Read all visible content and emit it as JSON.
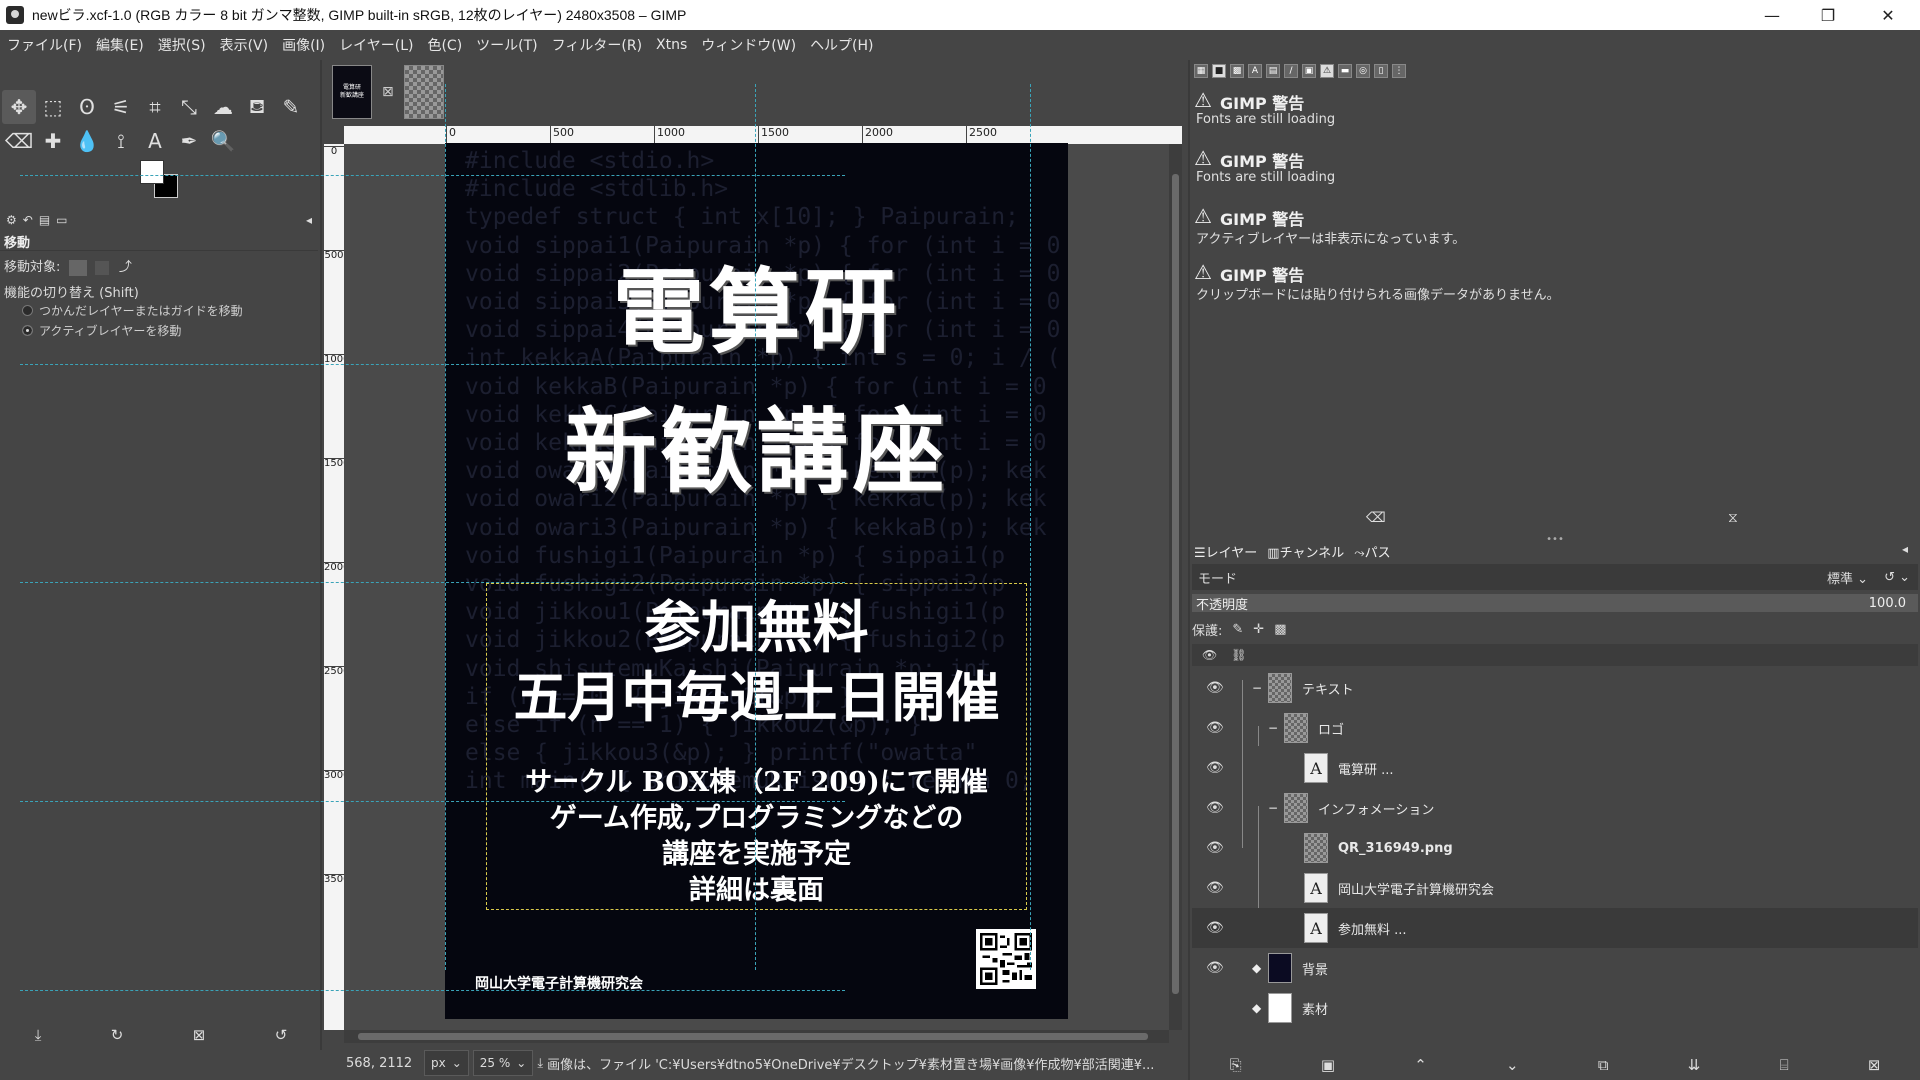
{
  "window": {
    "title": "newビラ.xcf-1.0 (RGB カラー 8 bit ガンマ整数, GIMP built-in sRGB, 12枚のレイヤー) 2480x3508 – GIMP",
    "minimize": "—",
    "maximize": "❐",
    "close": "✕"
  },
  "menu": [
    "ファイル(F)",
    "編集(E)",
    "選択(S)",
    "表示(V)",
    "画像(I)",
    "レイヤー(L)",
    "色(C)",
    "ツール(T)",
    "フィルター(R)",
    "Xtns",
    "ウィンドウ(W)",
    "ヘルプ(H)"
  ],
  "toolbox": {
    "tools_row1": [
      "move-icon",
      "rect-select-icon",
      "lasso-icon",
      "fuzzy-select-icon",
      "crop-icon",
      "transform-icon",
      "warp-icon",
      "bucket-fill-icon",
      "pencil-icon"
    ],
    "tools_row2": [
      "eraser-icon",
      "heal-icon",
      "smudge-icon",
      "paths-icon",
      "text-icon",
      "color-picker-icon",
      "zoom-icon"
    ],
    "tool_options_title": "移動",
    "move_target_label": "移動対象:",
    "toggle_label": "機能の切り替え (Shift)",
    "radio_pick": "つかんだレイヤーまたはガイドを移動",
    "radio_active": "アクティブレイヤーを移動"
  },
  "image": {
    "thumb_text": "電算研\n新歓講座",
    "ruler_top": [
      "0",
      "500",
      "1000",
      "1500",
      "2000",
      "2500"
    ],
    "ruler_left": [
      "0",
      "500",
      "1000",
      "1500",
      "2000",
      "2500",
      "3000",
      "3500"
    ],
    "poster": {
      "code_lines": [
        "#include <stdio.h>",
        "#include <stdlib.h>",
        "typedef struct { int x[10]; } Paipurain;",
        "void sippai1(Paipurain *p) { for (int i = 0",
        "void sippai2(Paipurain *p) { for (int i = 0",
        "void sippai3(Paipurain *p) { for (int i = 0",
        "void sippai4(Paipurain *p) { for (int i = 0",
        "int kekkaA(Paipurain *p) { int s = 0; i / (",
        "void kekkaB(Paipurain *p) { for (int i = 0",
        "void kekkaC(Paipurain *p) { for (int i = 0",
        "void kekkaC(Paipurain *p) { for (int i = 0",
        "void owari1(Paipurain *p) { kekkaA(p); kek",
        "void owari2(Paipurain *p) { kekkaC(p); kek",
        "void owari3(Paipurain *p) { kekkaB(p); kek",
        "void fushigi1(Paipurain *p) { sippai1(p",
        "void fushigi2(Paipurain *p) { sippai3(p",
        "void jikkou1(Paipurain *p) { fushigi1(p",
        "void jikkou2(Paipurain *p) { fushigi2(p",
        "void shisutemuKaishi(Paipurain *p; int",
        "if (n == 0) { jikkou1(&p); }",
        "else if (n == 1) { jikkou2(&p); }",
        "else { jikkou3(&p); } printf(\"owatta\"",
        "int main() { shisutemuKaishi(); return 0;"
      ],
      "title1": "電算研",
      "title2": "新歓講座",
      "free": "参加無料",
      "schedule": "五月中毎週土日開催",
      "info": [
        "サークル BOX棟（2F 209)にて開催",
        "ゲーム作成,プログラミングなどの",
        "講座を実施予定",
        "詳細は裏面"
      ],
      "org": "岡山大学電子計算機研究会"
    }
  },
  "status": {
    "coords": "568, 2112",
    "unit": "px",
    "zoom": "25 %",
    "message": "画像は、ファイル 'C:¥Users¥dtno5¥OneDrive¥デスクトップ¥素材置き場¥画像¥作成物¥部活関連¥..."
  },
  "messages": [
    {
      "title": "GIMP 警告",
      "body": "Fonts are still loading"
    },
    {
      "title": "GIMP 警告",
      "body": "Fonts are still loading"
    },
    {
      "title": "GIMP 警告",
      "body": "アクティブレイヤーは非表示になっています。"
    },
    {
      "title": "GIMP 警告",
      "body": "クリップボードには貼り付けられる画像データがありません。"
    }
  ],
  "layers_panel": {
    "tabs": [
      "レイヤー",
      "チャンネル",
      "パス"
    ],
    "mode_label": "モード",
    "mode_value": "標準",
    "opacity_label": "不透明度",
    "opacity_value": "100.0",
    "lock_label": "保護:",
    "layers": [
      {
        "name": "テキスト",
        "kind": "group"
      },
      {
        "name": "ロゴ",
        "kind": "group"
      },
      {
        "name": "電算研 ...",
        "kind": "text"
      },
      {
        "name": "インフォメーション",
        "kind": "group"
      },
      {
        "name": "QR_316949.png",
        "kind": "image"
      },
      {
        "name": "岡山大学電子計算機研究会",
        "kind": "text"
      },
      {
        "name": "参加無料 ...",
        "kind": "text"
      },
      {
        "name": "背景",
        "kind": "dark"
      },
      {
        "name": "素材",
        "kind": "white"
      }
    ]
  }
}
